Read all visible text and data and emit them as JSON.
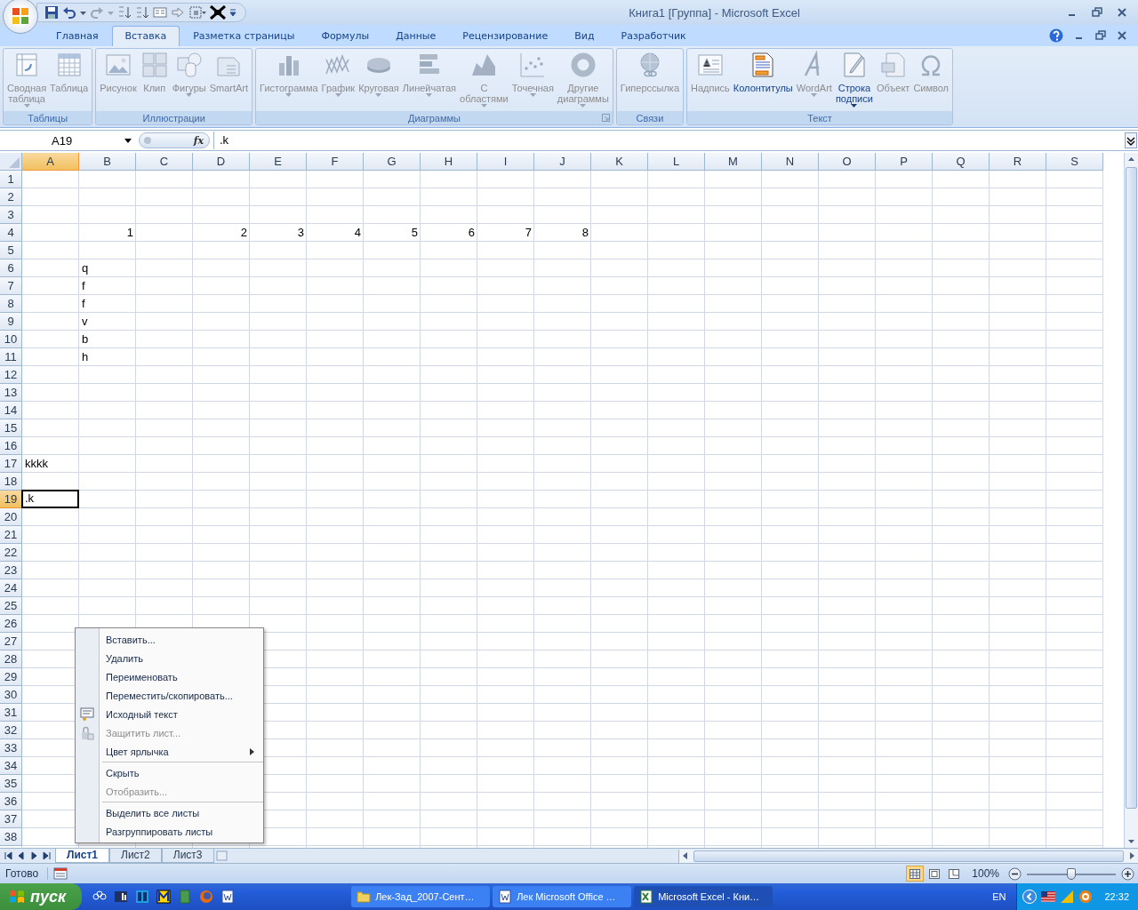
{
  "window": {
    "title": "Книга1  [Группа] - Microsoft Excel"
  },
  "tabs": [
    {
      "label": "Главная",
      "selected": false
    },
    {
      "label": "Вставка",
      "selected": true
    },
    {
      "label": "Разметка страницы",
      "selected": false
    },
    {
      "label": "Формулы",
      "selected": false
    },
    {
      "label": "Данные",
      "selected": false
    },
    {
      "label": "Рецензирование",
      "selected": false
    },
    {
      "label": "Вид",
      "selected": false
    },
    {
      "label": "Разработчик",
      "selected": false
    }
  ],
  "ribbon": {
    "groups": [
      {
        "label": "Таблицы",
        "launcher": false,
        "items": [
          {
            "label": "Сводная\nтаблица",
            "disabled": true,
            "dropdown": true
          },
          {
            "label": "Таблица",
            "disabled": true,
            "dropdown": false
          }
        ]
      },
      {
        "label": "Иллюстрации",
        "launcher": false,
        "items": [
          {
            "label": "Рисунок",
            "disabled": true,
            "dropdown": false
          },
          {
            "label": "Клип",
            "disabled": true,
            "dropdown": false
          },
          {
            "label": "Фигуры",
            "disabled": true,
            "dropdown": true
          },
          {
            "label": "SmartArt",
            "disabled": true,
            "dropdown": false
          }
        ]
      },
      {
        "label": "Диаграммы",
        "launcher": true,
        "items": [
          {
            "label": "Гистограмма",
            "disabled": true,
            "dropdown": true
          },
          {
            "label": "График",
            "disabled": true,
            "dropdown": true
          },
          {
            "label": "Круговая",
            "disabled": true,
            "dropdown": true
          },
          {
            "label": "Линейчатая",
            "disabled": true,
            "dropdown": true
          },
          {
            "label": "С\nобластями",
            "disabled": true,
            "dropdown": true
          },
          {
            "label": "Точечная",
            "disabled": true,
            "dropdown": true
          },
          {
            "label": "Другие\nдиаграммы",
            "disabled": true,
            "dropdown": true
          }
        ]
      },
      {
        "label": "Связи",
        "launcher": false,
        "items": [
          {
            "label": "Гиперссылка",
            "disabled": true,
            "dropdown": false
          }
        ]
      },
      {
        "label": "Текст",
        "launcher": false,
        "items": [
          {
            "label": "Надпись",
            "disabled": true,
            "dropdown": false
          },
          {
            "label": "Колонтитулы",
            "disabled": false,
            "dropdown": false
          },
          {
            "label": "WordArt",
            "disabled": true,
            "dropdown": true
          },
          {
            "label": "Строка\nподписи",
            "disabled": false,
            "dropdown": true
          },
          {
            "label": "Объект",
            "disabled": true,
            "dropdown": false
          },
          {
            "label": "Символ",
            "disabled": true,
            "dropdown": false
          }
        ]
      }
    ]
  },
  "formula_bar": {
    "name_box": "A19",
    "fx": "fx",
    "formula": ".k"
  },
  "columns": [
    {
      "label": "A",
      "selected": true
    },
    {
      "label": "B",
      "selected": false
    },
    {
      "label": "C",
      "selected": false
    },
    {
      "label": "D",
      "selected": false
    },
    {
      "label": "E",
      "selected": false
    },
    {
      "label": "F",
      "selected": false
    },
    {
      "label": "G",
      "selected": false
    },
    {
      "label": "H",
      "selected": false
    },
    {
      "label": "I",
      "selected": false
    },
    {
      "label": "J",
      "selected": false
    },
    {
      "label": "K",
      "selected": false
    },
    {
      "label": "L",
      "selected": false
    },
    {
      "label": "M",
      "selected": false
    },
    {
      "label": "N",
      "selected": false
    },
    {
      "label": "O",
      "selected": false
    },
    {
      "label": "P",
      "selected": false
    },
    {
      "label": "Q",
      "selected": false
    },
    {
      "label": "R",
      "selected": false
    },
    {
      "label": "S",
      "selected": false
    }
  ],
  "rows": [
    {
      "label": "1",
      "selected": false
    },
    {
      "label": "2",
      "selected": false
    },
    {
      "label": "3",
      "selected": false
    },
    {
      "label": "4",
      "selected": false,
      "cells": [
        null,
        {
          "value": "1",
          "kind": "number",
          "active": false
        },
        null,
        {
          "value": "2",
          "kind": "number",
          "active": false
        },
        {
          "value": "3",
          "kind": "number",
          "active": false
        },
        {
          "value": "4",
          "kind": "number",
          "active": false
        },
        {
          "value": "5",
          "kind": "number",
          "active": false
        },
        {
          "value": "6",
          "kind": "number",
          "active": false
        },
        {
          "value": "7",
          "kind": "number",
          "active": false
        },
        {
          "value": "8",
          "kind": "number",
          "active": false
        }
      ]
    },
    {
      "label": "5",
      "selected": false
    },
    {
      "label": "6",
      "selected": false,
      "cells": [
        null,
        {
          "value": "q",
          "kind": "text",
          "active": false
        }
      ]
    },
    {
      "label": "7",
      "selected": false,
      "cells": [
        null,
        {
          "value": "f",
          "kind": "text",
          "active": false
        }
      ]
    },
    {
      "label": "8",
      "selected": false,
      "cells": [
        null,
        {
          "value": "f",
          "kind": "text",
          "active": false
        }
      ]
    },
    {
      "label": "9",
      "selected": false,
      "cells": [
        null,
        {
          "value": "v",
          "kind": "text",
          "active": false
        }
      ]
    },
    {
      "label": "10",
      "selected": false,
      "cells": [
        null,
        {
          "value": "b",
          "kind": "text",
          "active": false
        }
      ]
    },
    {
      "label": "11",
      "selected": false,
      "cells": [
        null,
        {
          "value": "h",
          "kind": "text",
          "active": false
        }
      ]
    },
    {
      "label": "12",
      "selected": false
    },
    {
      "label": "13",
      "selected": false
    },
    {
      "label": "14",
      "selected": false
    },
    {
      "label": "15",
      "selected": false
    },
    {
      "label": "16",
      "selected": false
    },
    {
      "label": "17",
      "selected": false,
      "cells": [
        {
          "value": "kkkk",
          "kind": "text",
          "active": false
        }
      ]
    },
    {
      "label": "18",
      "selected": false
    },
    {
      "label": "19",
      "selected": true,
      "cells": [
        {
          "value": ".k",
          "kind": "text",
          "active": true
        }
      ]
    },
    {
      "label": "20",
      "selected": false
    },
    {
      "label": "21",
      "selected": false
    },
    {
      "label": "22",
      "selected": false
    },
    {
      "label": "23",
      "selected": false
    },
    {
      "label": "24",
      "selected": false
    },
    {
      "label": "25",
      "selected": false
    },
    {
      "label": "26",
      "selected": false
    },
    {
      "label": "27",
      "selected": false
    },
    {
      "label": "28",
      "selected": false
    },
    {
      "label": "29",
      "selected": false
    },
    {
      "label": "30",
      "selected": false
    },
    {
      "label": "31",
      "selected": false
    },
    {
      "label": "32",
      "selected": false
    },
    {
      "label": "33",
      "selected": false
    },
    {
      "label": "34",
      "selected": false
    },
    {
      "label": "35",
      "selected": false
    },
    {
      "label": "36",
      "selected": false
    },
    {
      "label": "37",
      "selected": false
    },
    {
      "label": "38",
      "selected": false
    }
  ],
  "context_menu": [
    {
      "kind": "item",
      "label": "Вставить...",
      "has_icon": false,
      "disabled": false,
      "submenu": false
    },
    {
      "kind": "item",
      "label": "Удалить",
      "has_icon": false,
      "disabled": false,
      "submenu": false
    },
    {
      "kind": "item",
      "label": "Переименовать",
      "has_icon": false,
      "disabled": false,
      "submenu": false
    },
    {
      "kind": "item",
      "label": "Переместить/скопировать...",
      "has_icon": false,
      "disabled": false,
      "submenu": false
    },
    {
      "kind": "item",
      "label": "Исходный текст",
      "has_icon": true,
      "disabled": false,
      "submenu": false
    },
    {
      "kind": "item",
      "label": "Защитить лист...",
      "has_icon": true,
      "disabled": true,
      "submenu": false
    },
    {
      "kind": "item",
      "label": "Цвет ярлычка",
      "has_icon": false,
      "disabled": false,
      "submenu": true
    },
    {
      "kind": "separator"
    },
    {
      "kind": "item",
      "label": "Скрыть",
      "has_icon": false,
      "disabled": false,
      "submenu": false
    },
    {
      "kind": "item",
      "label": "Отобразить...",
      "has_icon": false,
      "disabled": true,
      "submenu": false
    },
    {
      "kind": "separator"
    },
    {
      "kind": "item",
      "label": "Выделить все листы",
      "has_icon": false,
      "disabled": false,
      "submenu": false
    },
    {
      "kind": "item",
      "label": "Разгруппировать листы",
      "has_icon": false,
      "disabled": false,
      "submenu": false
    }
  ],
  "sheet_tabs": [
    {
      "label": "Лист1",
      "selected": true
    },
    {
      "label": "Лист2",
      "selected": false
    },
    {
      "label": "Лист3",
      "selected": false
    }
  ],
  "status_bar": {
    "status": "Готово",
    "views": [
      {
        "selected": true
      },
      {
        "selected": false
      },
      {
        "selected": false
      }
    ],
    "zoom": "100%",
    "zoom_level": {
      "level": 0.5
    }
  },
  "taskbar": {
    "start": "пуск",
    "tasks": [
      {
        "label": "Лек-Зад_2007-Сент…",
        "selected": false
      },
      {
        "label": "Лек Microsoft Office …",
        "selected": false
      },
      {
        "label": "Microsoft Excel - Кни…",
        "selected": true
      }
    ],
    "language": "EN",
    "clock": "22:32"
  }
}
